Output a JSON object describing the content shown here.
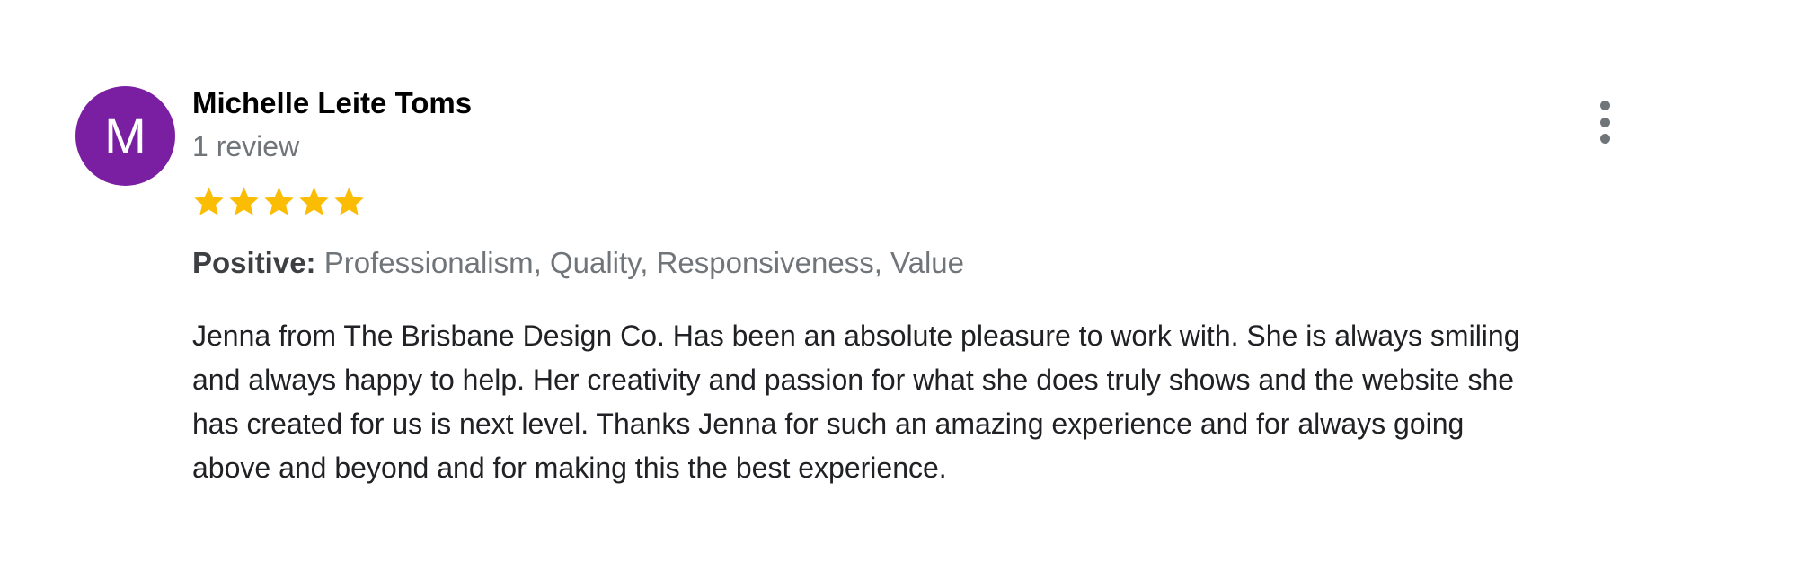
{
  "review": {
    "avatar_initial": "M",
    "avatar_color": "#7b1fa2",
    "author_name": "Michelle Leite Toms",
    "review_count": "1 review",
    "rating": 5,
    "rating_max": 5,
    "star_color": "#fbbc04",
    "attributes_label": "Positive:",
    "attributes_values": " Professionalism, Quality, Responsiveness, Value",
    "text_lines": [
      "Jenna from The Brisbane Design Co. Has been an absolute pleasure to work with. She is always smiling",
      "and always happy to help. Her creativity and passion for what she does truly shows and the website she",
      "has created for us is next level. Thanks Jenna for such an amazing experience and for always going",
      "above and beyond and for making this the best experience."
    ],
    "more_icon": "more-vert-icon"
  }
}
